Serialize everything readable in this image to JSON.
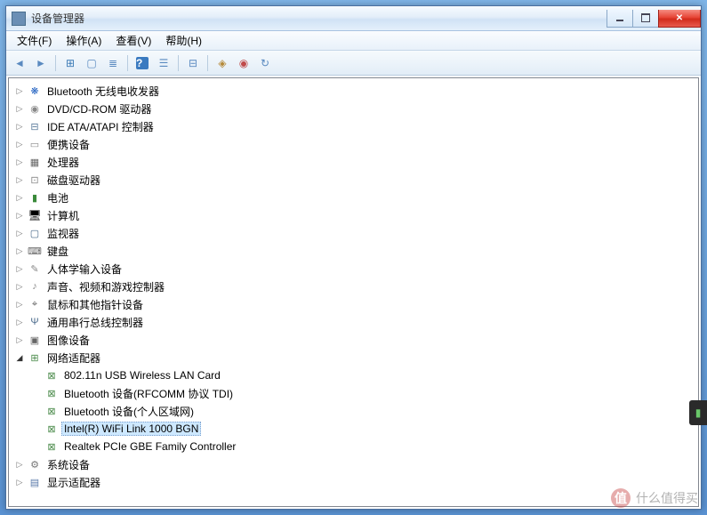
{
  "window": {
    "title": "设备管理器"
  },
  "menu": {
    "file": "文件(F)",
    "action": "操作(A)",
    "view": "查看(V)",
    "help": "帮助(H)"
  },
  "tree": [
    {
      "label": "Bluetooth 无线电收发器",
      "icon": "ic-bt",
      "exp": "▷"
    },
    {
      "label": "DVD/CD-ROM 驱动器",
      "icon": "ic-disc",
      "exp": "▷"
    },
    {
      "label": "IDE ATA/ATAPI 控制器",
      "icon": "ic-ide",
      "exp": "▷"
    },
    {
      "label": "便携设备",
      "icon": "ic-port",
      "exp": "▷"
    },
    {
      "label": "处理器",
      "icon": "ic-cpu",
      "exp": "▷"
    },
    {
      "label": "磁盘驱动器",
      "icon": "ic-hdd",
      "exp": "▷"
    },
    {
      "label": "电池",
      "icon": "ic-bat",
      "exp": "▷"
    },
    {
      "label": "计算机",
      "icon": "ic-pc",
      "exp": "▷"
    },
    {
      "label": "监视器",
      "icon": "ic-mon",
      "exp": "▷"
    },
    {
      "label": "键盘",
      "icon": "ic-kb",
      "exp": "▷"
    },
    {
      "label": "人体学输入设备",
      "icon": "ic-hid",
      "exp": "▷"
    },
    {
      "label": "声音、视频和游戏控制器",
      "icon": "ic-snd",
      "exp": "▷"
    },
    {
      "label": "鼠标和其他指针设备",
      "icon": "ic-mouse",
      "exp": "▷"
    },
    {
      "label": "通用串行总线控制器",
      "icon": "ic-usb",
      "exp": "▷"
    },
    {
      "label": "图像设备",
      "icon": "ic-img",
      "exp": "▷"
    },
    {
      "label": "网络适配器",
      "icon": "ic-net",
      "exp": "◢",
      "expanded": true,
      "children": [
        {
          "label": "802.11n USB Wireless LAN Card",
          "icon": "ic-netc"
        },
        {
          "label": "Bluetooth 设备(RFCOMM 协议 TDI)",
          "icon": "ic-netc"
        },
        {
          "label": "Bluetooth 设备(个人区域网)",
          "icon": "ic-netc"
        },
        {
          "label": "Intel(R) WiFi Link 1000 BGN",
          "icon": "ic-netc",
          "selected": true
        },
        {
          "label": "Realtek PCIe GBE Family Controller",
          "icon": "ic-netc"
        }
      ]
    },
    {
      "label": "系统设备",
      "icon": "ic-sys",
      "exp": "▷"
    },
    {
      "label": "显示适配器",
      "icon": "ic-disp",
      "exp": "▷"
    }
  ],
  "watermark": {
    "logo": "值",
    "text": "什么值得买"
  }
}
